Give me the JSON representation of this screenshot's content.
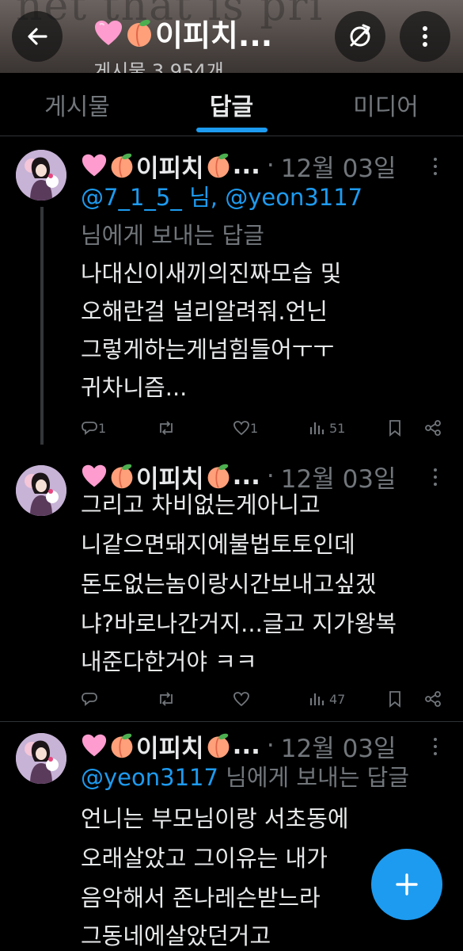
{
  "header": {
    "banner_text": "net that is pri",
    "title_hearts": "🩷",
    "title_name": "이피치...",
    "post_count": "게시물 3,954개"
  },
  "tabs": [
    {
      "label": "게시물",
      "active": false
    },
    {
      "label": "답글",
      "active": true
    },
    {
      "label": "미디어",
      "active": false
    }
  ],
  "posts": [
    {
      "name": "이피치",
      "ellipsis": "...",
      "dot": "·",
      "date": "12월 03일",
      "reply_line_1": "@7_1_5_ 님, @yeon3117",
      "reply_mentions": [
        "@7_1_5_",
        "님,",
        "@yeon3117"
      ],
      "reply_line_2": "님에게 보내는 답글",
      "lines": [
        "나대신이새끼의진짜모습 및",
        "오해란걸 널리알려줘.언닌",
        "그렇게하는게넘힘들어ㅜㅜ",
        "귀차니즘..."
      ],
      "replies": "1",
      "retweets": "",
      "likes": "1",
      "views": "51"
    },
    {
      "name": "이피치",
      "ellipsis": "...",
      "dot": "·",
      "date": "12월 03일",
      "lines": [
        "그리고 차비없는게아니고",
        "니같으면돼지에불법토토인데",
        "돈도없는놈이랑시간보내고싶겠",
        "냐?바로나간거지...글고 지가왕복",
        "내준다한거야 ㅋㅋ"
      ],
      "replies": "",
      "retweets": "",
      "likes": "",
      "views": "47"
    },
    {
      "name": "이피치",
      "ellipsis": "...",
      "dot": "·",
      "date": "12월 03일",
      "reply_mention": "@yeon3117",
      "reply_suffix": "님에게 보내는 답글",
      "lines": [
        "언니는 부모님이랑 서초동에",
        "오래살았고 그이유는 내가",
        "음악해서 존나레슨받느라",
        "그동네에살았던거고"
      ]
    }
  ],
  "fab": {
    "icon": "plus-icon"
  },
  "colors": {
    "accent": "#1d9bf0",
    "muted": "#71767b",
    "text": "#e7e9ea",
    "background": "#000000"
  }
}
